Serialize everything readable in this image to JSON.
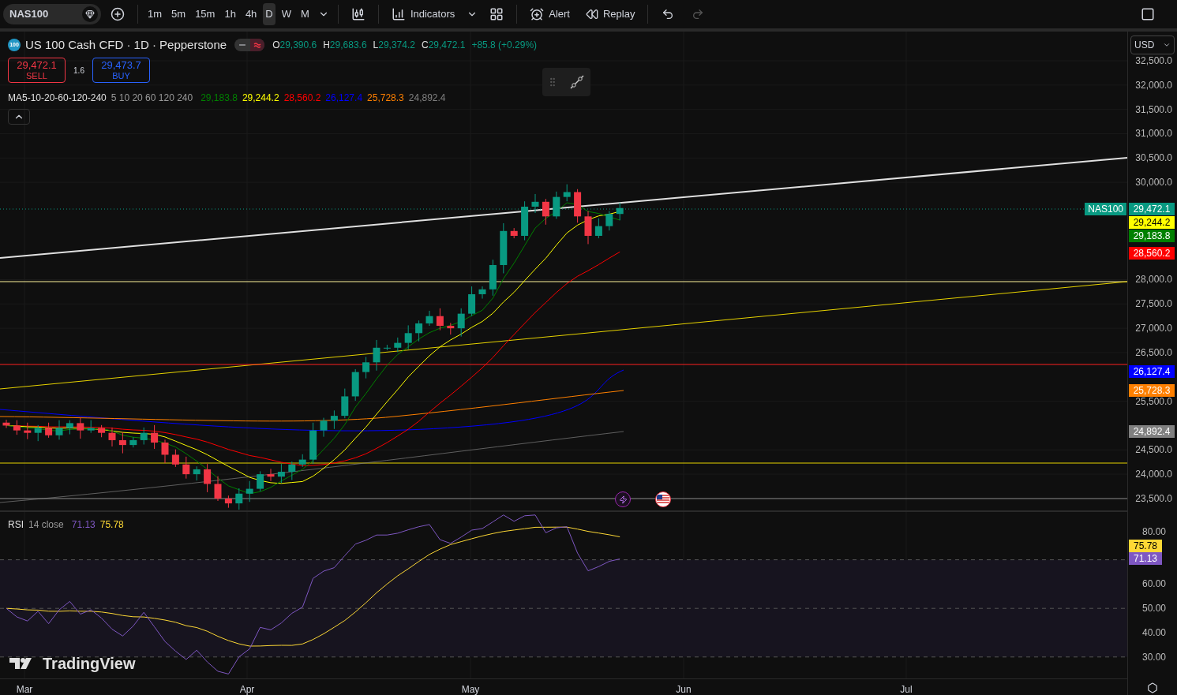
{
  "toolbar": {
    "symbol": "NAS100",
    "intervals": [
      {
        "label": "1m",
        "selected": false
      },
      {
        "label": "5m",
        "selected": false
      },
      {
        "label": "15m",
        "selected": false
      },
      {
        "label": "1h",
        "selected": false
      },
      {
        "label": "4h",
        "selected": false
      },
      {
        "label": "D",
        "selected": true
      },
      {
        "label": "W",
        "selected": false
      },
      {
        "label": "M",
        "selected": false
      }
    ],
    "indicators_label": "Indicators",
    "alert_label": "Alert",
    "replay_label": "Replay"
  },
  "legend": {
    "exchange_badge": "100",
    "title": "US 100 Cash CFD · 1D · Pepperstone",
    "ohlc": [
      {
        "key": "O",
        "value": "29,390.6"
      },
      {
        "key": "H",
        "value": "29,683.6"
      },
      {
        "key": "L",
        "value": "29,374.2"
      },
      {
        "key": "C",
        "value": "29,472.1"
      }
    ],
    "change": "+85.8 (+0.29%)"
  },
  "trade": {
    "sell": {
      "price": "29,472.1",
      "label": "SELL"
    },
    "spread": "1.6",
    "buy": {
      "price": "29,473.7",
      "label": "BUY"
    }
  },
  "ma_legend": {
    "name": "MA5-10-20-60-120-240",
    "params": "5 10 20 60 120 240",
    "values": [
      {
        "value": "29,183.8",
        "color": "#008000"
      },
      {
        "value": "29,244.2",
        "color": "#ffff00"
      },
      {
        "value": "28,560.2",
        "color": "#ff0000"
      },
      {
        "value": "26,127.4",
        "color": "#0000ff"
      },
      {
        "value": "25,728.3",
        "color": "#ff8000"
      },
      {
        "value": "24,892.4",
        "color": "#808080"
      }
    ]
  },
  "price_axis": {
    "currency": "USD",
    "labels": [
      "32,500.0",
      "32,000.0",
      "31,500.0",
      "31,000.0",
      "30,500.0",
      "30,000.0",
      "28,000.0",
      "27,500.0",
      "27,000.0",
      "26,500.0",
      "25,500.0",
      "24,500.0",
      "24,000.0",
      "23,500.0"
    ],
    "symbol_tag": "NAS100",
    "badges": [
      {
        "value": "29,472.1",
        "color": "#089981"
      },
      {
        "value": "29,244.2",
        "color": "#ffff00"
      },
      {
        "value": "29,183.8",
        "color": "#008000"
      },
      {
        "value": "28,560.2",
        "color": "#ff0000"
      },
      {
        "value": "26,127.4",
        "color": "#0000ff"
      },
      {
        "value": "25,728.3",
        "color": "#ff8000"
      },
      {
        "value": "24,892.4",
        "color": "#808080"
      }
    ]
  },
  "rsi": {
    "name": "RSI",
    "params": "14 close",
    "values": [
      {
        "value": "71.13",
        "color": "#7e57c2"
      },
      {
        "value": "75.78",
        "color": "#fdd835"
      }
    ],
    "axis_labels": [
      "80.00",
      "60.00",
      "50.00",
      "40.00",
      "30.00"
    ],
    "badges": [
      {
        "value": "75.78",
        "color": "#fdd835"
      },
      {
        "value": "71.13",
        "color": "#7e57c2"
      }
    ]
  },
  "time_axis": {
    "labels": [
      "Mar",
      "Apr",
      "May",
      "Jun",
      "Jul"
    ]
  },
  "branding": {
    "logo_text": "TradingView"
  }
}
